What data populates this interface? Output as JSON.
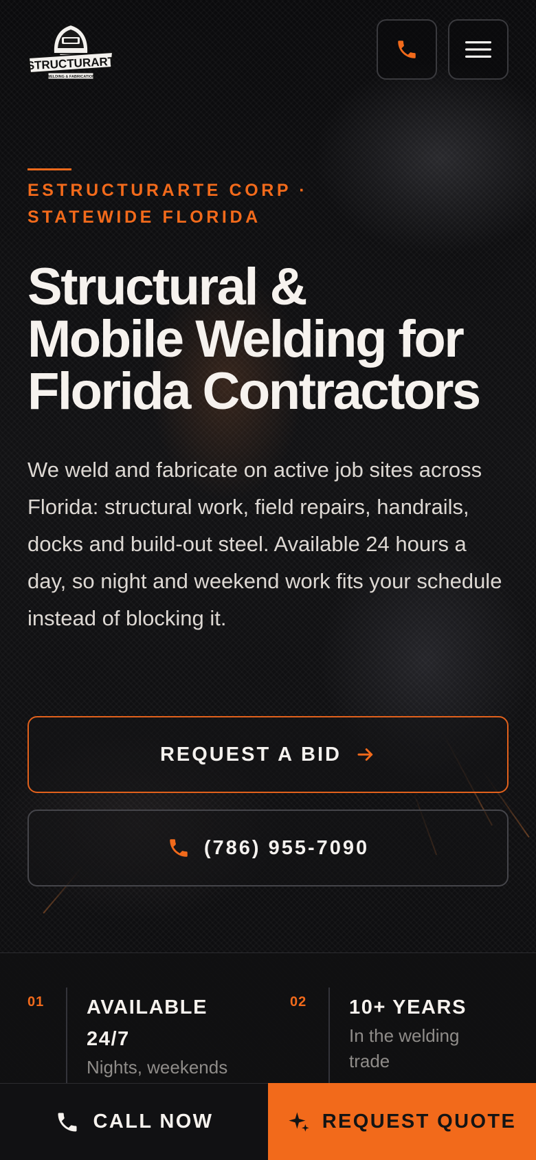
{
  "brand": {
    "logo_text": "ESTRUCTURARTE",
    "logo_subtext": "WELDING & FABRICATION"
  },
  "colors": {
    "accent": "#f26a1b",
    "background": "#0c0c0e",
    "text": "#f4f1ee"
  },
  "header": {
    "phone_icon": "phone-icon",
    "menu_icon": "hamburger-menu-icon"
  },
  "hero": {
    "eyebrow_line1": "ESTRUCTURARTE CORP ·",
    "eyebrow_line2": "STATEWIDE FLORIDA",
    "title_line1": "Structural &",
    "title_line2": "Mobile Welding for",
    "title_line3": "Florida Contractors",
    "description": "We weld and fabricate on active job sites across Florida: structural work, field repairs, handrails, docks and build‑out steel. Available 24 hours a day, so night and weekend work fits your schedule instead of blocking it.",
    "cta_bid": "REQUEST A BID",
    "cta_phone": "(786) 955-7090"
  },
  "stats": [
    {
      "number": "01",
      "title_line1": "AVAILABLE",
      "title_line2": "24/7",
      "desc": "Nights, weekends"
    },
    {
      "number": "02",
      "title_line1": "10+ YEARS",
      "desc_line1": "In the welding",
      "desc_line2": "trade"
    }
  ],
  "bottom_bar": {
    "call_label": "CALL NOW",
    "quote_label": "REQUEST QUOTE"
  }
}
